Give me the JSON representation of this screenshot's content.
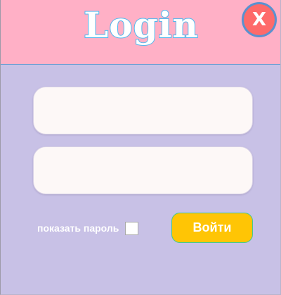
{
  "header": {
    "title": "Login",
    "close_label": "X"
  },
  "form": {
    "username_value": "",
    "password_value": "",
    "show_password_label": "показать пароль",
    "show_password_checked": false,
    "submit_label": "Войти"
  },
  "colors": {
    "window_background": "#c8c1e6",
    "header_background": "#ffb0c6",
    "title_fill": "#ffffff",
    "title_outline": "#4fb8ee",
    "close_button": "#fe6a6a",
    "submit_button": "#ffc505",
    "input_background": "#fdf8f7"
  },
  "icons": {
    "close": "close-icon"
  }
}
